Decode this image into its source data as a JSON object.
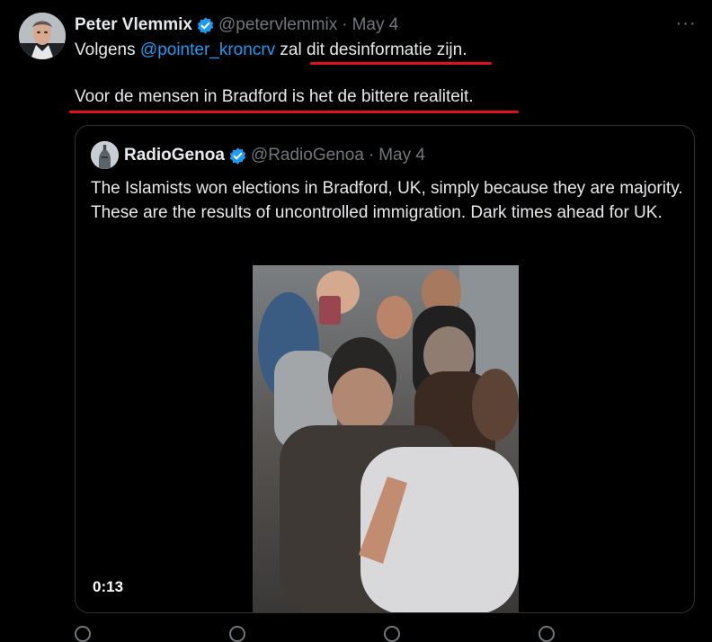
{
  "tweet": {
    "author_name": "Peter Vlemmix",
    "handle": "@petervlemmix",
    "separator": "·",
    "date": "May 4",
    "more_label": "···",
    "text_prefix": "Volgens ",
    "mention": "@pointer_kroncrv",
    "text_middle": " zal ",
    "text_underlined": "dit desinformatie zijn",
    "text_suffix": ".",
    "line2": "Voor de mensen in Bradford is het de bittere realiteit."
  },
  "quoted": {
    "author_name": "RadioGenoa",
    "handle": "@RadioGenoa",
    "separator": "·",
    "date": "May 4",
    "text": "The Islamists won elections in Bradford, UK, simply because they are majority. These are the results of uncontrolled immigration. Dark times ahead for UK.",
    "video_time": "0:13"
  },
  "colors": {
    "background": "#000000",
    "text": "#e7e9ea",
    "muted": "#71767b",
    "link": "#1d9bf0",
    "verified": "#1d9bf0",
    "annotation_underline": "#e0111a",
    "border": "#2f3336"
  },
  "icons": [
    "avatar",
    "verified-badge-icon",
    "more-icon",
    "video-player"
  ]
}
